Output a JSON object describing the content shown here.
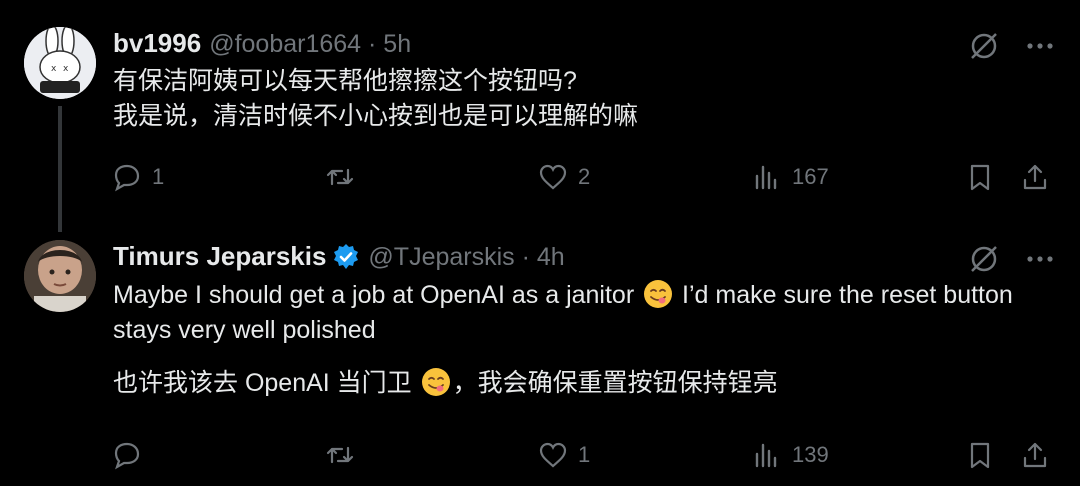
{
  "tweets": [
    {
      "author": {
        "name": "bv1996",
        "handle": "@foobar1664 · 5h",
        "verified": false
      },
      "text_lines": [
        "有保洁阿姨可以每天帮他擦擦这个按钮吗?",
        "我是说，清洁时候不小心按到也是可以理解的嘛"
      ],
      "stats": {
        "replies": "1",
        "retweets": "",
        "likes": "2",
        "views": "167"
      }
    },
    {
      "author": {
        "name": "Timurs Jeparskis",
        "handle": "@TJeparskis · 4h",
        "verified": true
      },
      "text_en_before_emoji": "Maybe I should get a job at OpenAI as a janitor",
      "text_en_after_emoji": " I’d make sure the reset button stays very well polished",
      "text_zh_before_emoji": "也许我该去 OpenAI 当门卫",
      "text_zh_after_emoji": "，我会确保重置按钮保持锃亮",
      "stats": {
        "replies": "",
        "retweets": "",
        "likes": "1",
        "views": "139"
      }
    }
  ],
  "icons": {
    "grok": "no-entry-circle-icon",
    "more": "more-dots-icon",
    "reply": "reply-bubble-icon",
    "retweet": "retweet-icon",
    "like": "heart-icon",
    "views": "bar-chart-icon",
    "bookmark": "bookmark-icon",
    "share": "share-upload-icon",
    "emoji": "savoring-food-emoji"
  },
  "colors": {
    "background": "#000000",
    "text": "#e7e9ea",
    "muted": "#71767b",
    "verified": "#1d9bf0"
  }
}
